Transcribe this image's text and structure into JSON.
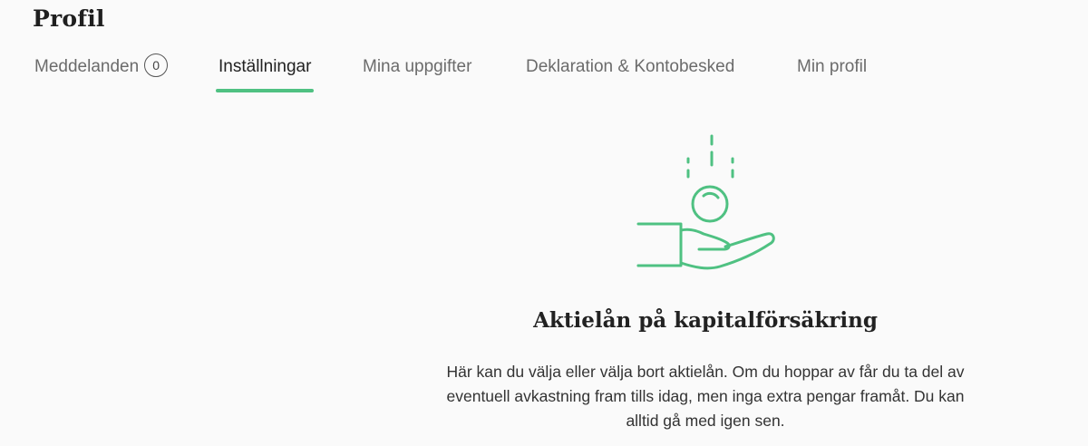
{
  "page": {
    "title": "Profil"
  },
  "tabs": [
    {
      "label": "Meddelanden",
      "badge": "0",
      "active": false
    },
    {
      "label": "Inställningar",
      "active": true
    },
    {
      "label": "Mina uppgifter",
      "active": false
    },
    {
      "label": "Deklaration & Kontobesked",
      "active": false
    },
    {
      "label": "Min profil",
      "active": false
    }
  ],
  "content": {
    "illustration_icon": "hand-with-falling-coin-icon",
    "heading": "Aktielån på kapitalförsäkring",
    "description": "Här kan du välja eller välja bort aktielån. Om du hoppar av får du ta del av eventuell avkastning fram tills idag, men inga extra pengar framåt. Du kan alltid gå med igen sen."
  },
  "colors": {
    "accent": "#4fc182",
    "background": "#fafafa",
    "text": "#222222",
    "muted": "#6b6b6b"
  }
}
